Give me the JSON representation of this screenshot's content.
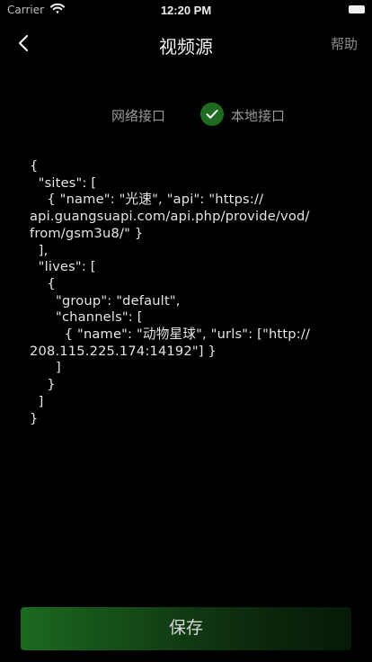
{
  "status_bar": {
    "carrier": "Carrier",
    "time": "12:20 PM",
    "wifi_icon": "wifi-icon",
    "battery_icon": "battery-icon"
  },
  "nav": {
    "back_icon": "chevron-left-icon",
    "title": "视频源",
    "help_label": "帮助"
  },
  "source_switch": {
    "remote_label": "网络接口",
    "local_label": "本地接口",
    "selected": "本地接口",
    "check_icon": "checkmark-icon",
    "accent_color": "#1f6b22"
  },
  "config": {
    "text": "{\n  \"sites\": [\n    { \"name\": \"光速\", \"api\": \"https://\napi.guangsuapi.com/api.php/provide/vod/\nfrom/gsm3u8/\" }\n  ],\n  \"lives\": [\n    {\n      \"group\": \"default\",\n      \"channels\": [\n        { \"name\": \"动物星球\", \"urls\": [\"http://\n208.115.225.174:14192\"] }\n      ]\n    }\n  ]\n}"
  },
  "save": {
    "label": "保存",
    "color": "#1b6a1f"
  }
}
